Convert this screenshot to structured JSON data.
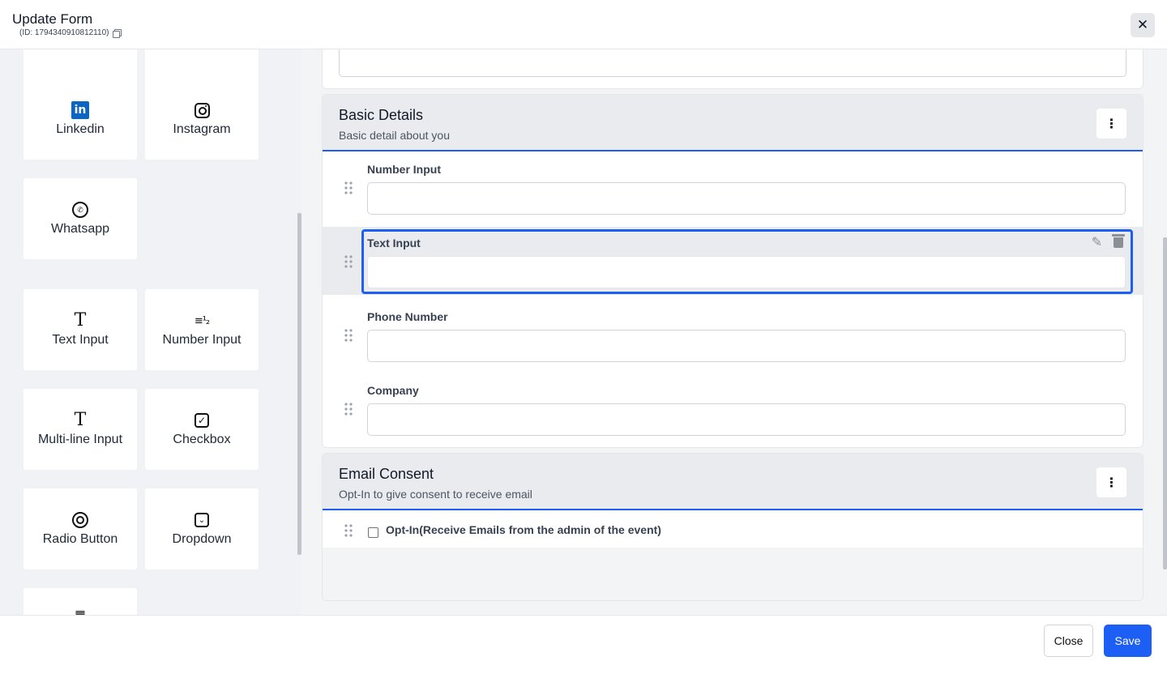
{
  "header": {
    "title": "Update Form",
    "id_text": "(ID: 1794340910812110)"
  },
  "palette": {
    "tiles": [
      {
        "label": "Linkedin",
        "icon": "linkedin-icon"
      },
      {
        "label": "Instagram",
        "icon": "instagram-icon"
      },
      {
        "label": "Whatsapp",
        "icon": "whatsapp-icon"
      },
      {
        "label": "Text Input",
        "icon": "text-input-icon"
      },
      {
        "label": "Number Input",
        "icon": "number-input-icon"
      },
      {
        "label": "Multi-line Input",
        "icon": "multiline-input-icon"
      },
      {
        "label": "Checkbox",
        "icon": "checkbox-icon"
      },
      {
        "label": "Radio Button",
        "icon": "radio-button-icon"
      },
      {
        "label": "Dropdown",
        "icon": "dropdown-icon"
      }
    ]
  },
  "sections": [
    {
      "title": "Basic Details",
      "description": "Basic detail about you",
      "fields": [
        {
          "label": "Number Input",
          "value": ""
        },
        {
          "label": "Text Input",
          "value": "",
          "selected": true
        },
        {
          "label": "Phone Number",
          "value": ""
        },
        {
          "label": "Company",
          "value": ""
        }
      ]
    },
    {
      "title": "Email Consent",
      "description": "Opt-In to give consent to receive email",
      "checkbox_label": "Opt-In(Receive Emails from the admin of the event)",
      "checkbox_checked": false
    }
  ],
  "footer": {
    "close_label": "Close",
    "save_label": "Save"
  },
  "colors": {
    "accent": "#1d5ff5",
    "linkedin": "#0a66c2"
  }
}
